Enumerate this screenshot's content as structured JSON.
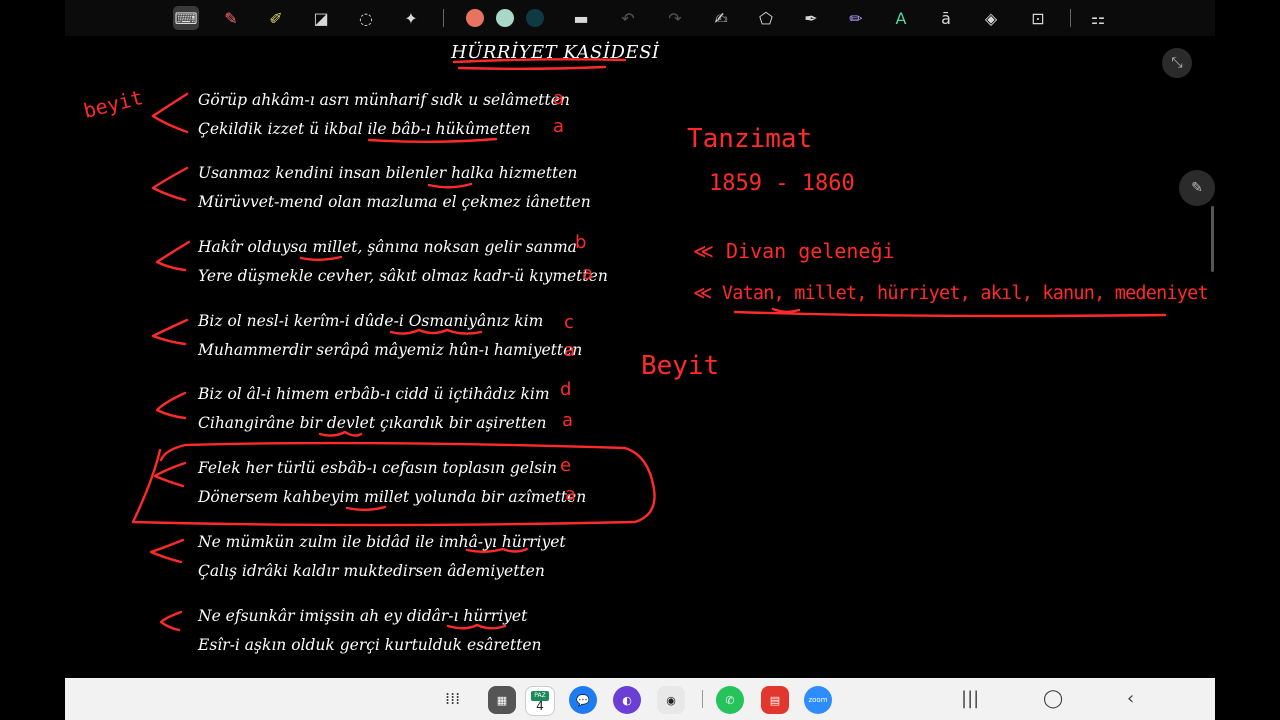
{
  "document": {
    "title": "HÜRRİYET KASİDESİ",
    "verses": [
      {
        "line1": "Görüp ahkâm-ı asrı münharif sıdk u selâmetten",
        "line2": "Çekildik izzet ü ikbal ile bâb-ı hükûmetten",
        "rhyme1": "a",
        "rhyme2": "a"
      },
      {
        "line1": "Usanmaz kendini insan bilenler halka hizmetten",
        "line2": "Mürüvvet-mend olan mazluma el çekmez iânetten",
        "rhyme1": "",
        "rhyme2": ""
      },
      {
        "line1": "Hakîr olduysa millet, şânına noksan gelir sanma",
        "line2": "Yere düşmekle cevher, sâkıt olmaz kadr-ü kıymetten",
        "rhyme1": "b",
        "rhyme2": "a"
      },
      {
        "line1": "Biz ol nesl-i kerîm-i dûde-i Osmaniyânız kim",
        "line2": "Muhammerdir serâpâ mâyemiz hûn-ı hamiyetten",
        "rhyme1": "c",
        "rhyme2": "a"
      },
      {
        "line1": "Biz ol âl-i himem erbâb-ı cidd ü içtihâdız kim",
        "line2": "Cihangirâne bir devlet çıkardık bir aşiretten",
        "rhyme1": "d",
        "rhyme2": "a"
      },
      {
        "line1": "Felek her türlü esbâb-ı cefasın toplasın gelsin",
        "line2": "Dönersem kahbeyim millet yolunda bir azîmetten",
        "rhyme1": "e",
        "rhyme2": "a"
      },
      {
        "line1": "Ne mümkün zulm ile bidâd ile imhâ-yı hürriyet",
        "line2": "Çalış idrâki kaldır muktedirsen âdemiyetten",
        "rhyme1": "",
        "rhyme2": ""
      },
      {
        "line1": "Ne efsunkâr imişsin ah ey didâr-ı hürriyet",
        "line2": "Esîr-i aşkın olduk gerçi kurtulduk esâretten",
        "rhyme1": "",
        "rhyme2": ""
      }
    ]
  },
  "annotations": {
    "beyit_left": "beyit",
    "tanzimat": "Tanzimat",
    "years": "1859 - 1860",
    "bullet1": "Divan geleneği",
    "bullet2": "Vatan, millet, hürriyet, akıl, kanun, medeniyet",
    "beyit_right": "Beyit"
  },
  "toolbar": {
    "tools": [
      "keyboard-icon",
      "pen-icon",
      "highlighter-icon",
      "eraser-icon",
      "lasso-icon",
      "magic-icon",
      "undo-icon",
      "redo-icon",
      "shape-pen-icon",
      "shape-icon",
      "text-pen-icon",
      "pencil-icon",
      "text-style-icon",
      "text-box-icon",
      "sticker-icon",
      "lock-icon",
      "more-icon"
    ],
    "colors": [
      "#e8735e",
      "#a8d8c8",
      "#0e3a44"
    ]
  },
  "taskbar": {
    "calendar_day": "PAZ",
    "calendar_date": "4",
    "zoom_label": "zoom",
    "accent": "#ff2a2a"
  }
}
